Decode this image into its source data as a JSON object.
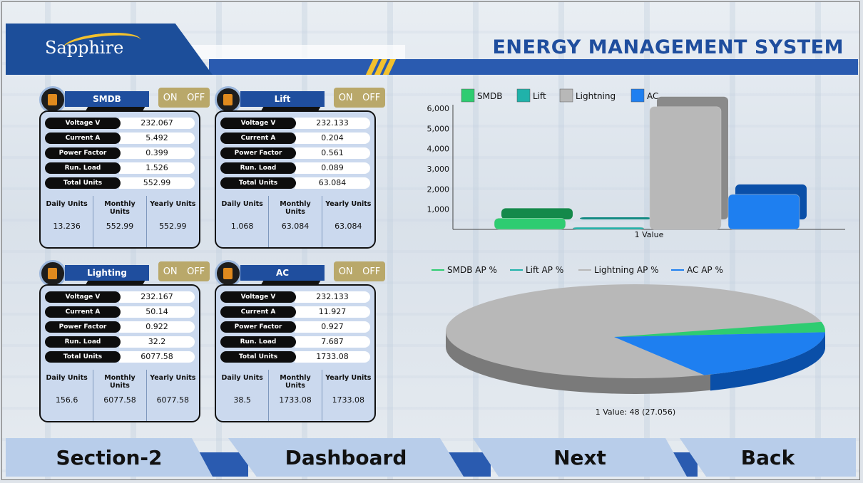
{
  "header": {
    "logo_text": "Sapphire",
    "title": "ENERGY  MANAGEMENT SYSTEM"
  },
  "panels": [
    {
      "name": "SMDB",
      "on_label": "ON",
      "off_label": "OFF",
      "rows": [
        {
          "label": "Voltage V",
          "value": "232.067"
        },
        {
          "label": "Current A",
          "value": "5.492"
        },
        {
          "label": "Power Factor",
          "value": "0.399"
        },
        {
          "label": "Run. Load",
          "value": "1.526"
        },
        {
          "label": "Total Units",
          "value": "552.99"
        }
      ],
      "stats": [
        {
          "label": "Daily Units",
          "value": "13.236"
        },
        {
          "label": "Monthly Units",
          "value": "552.99"
        },
        {
          "label": "Yearly Units",
          "value": "552.99"
        }
      ]
    },
    {
      "name": "Lift",
      "on_label": "ON",
      "off_label": "OFF",
      "rows": [
        {
          "label": "Voltage V",
          "value": "232.133"
        },
        {
          "label": "Current A",
          "value": "0.204"
        },
        {
          "label": "Power Factor",
          "value": "0.561"
        },
        {
          "label": "Run. Load",
          "value": "0.089"
        },
        {
          "label": "Total Units",
          "value": "63.084"
        }
      ],
      "stats": [
        {
          "label": "Daily Units",
          "value": "1.068"
        },
        {
          "label": "Monthly Units",
          "value": "63.084"
        },
        {
          "label": "Yearly Units",
          "value": "63.084"
        }
      ]
    },
    {
      "name": "Lighting",
      "on_label": "ON",
      "off_label": "OFF",
      "rows": [
        {
          "label": "Voltage V",
          "value": "232.167"
        },
        {
          "label": "Current A",
          "value": "50.14"
        },
        {
          "label": "Power Factor",
          "value": "0.922"
        },
        {
          "label": "Run. Load",
          "value": "32.2"
        },
        {
          "label": "Total Units",
          "value": "6077.58"
        }
      ],
      "stats": [
        {
          "label": "Daily Units",
          "value": "156.6"
        },
        {
          "label": "Monthly Units",
          "value": "6077.58"
        },
        {
          "label": "Yearly Units",
          "value": "6077.58"
        }
      ]
    },
    {
      "name": "AC",
      "on_label": "ON",
      "off_label": "OFF",
      "rows": [
        {
          "label": "Voltage V",
          "value": "232.133"
        },
        {
          "label": "Current A",
          "value": "11.927"
        },
        {
          "label": "Power Factor",
          "value": "0.927"
        },
        {
          "label": "Run. Load",
          "value": "7.687"
        },
        {
          "label": "Total Units",
          "value": "1733.08"
        }
      ],
      "stats": [
        {
          "label": "Daily Units",
          "value": "38.5"
        },
        {
          "label": "Monthly Units",
          "value": "1733.08"
        },
        {
          "label": "Yearly Units",
          "value": "1733.08"
        }
      ]
    }
  ],
  "bar_chart": {
    "legend": [
      "SMDB",
      "Lift",
      "Lightning",
      "AC"
    ],
    "x_label": "1 Value",
    "y_ticks": [
      "1,000",
      "2,000",
      "3,000",
      "4,000",
      "5,000",
      "6,000"
    ]
  },
  "pie_chart": {
    "legend": [
      "SMDB AP %",
      "Lift AP %",
      "Lightning AP %",
      "AC AP %"
    ],
    "caption": "1 Value: 48 (27.056)"
  },
  "chart_data": [
    {
      "type": "bar",
      "categories": [
        "1 Value"
      ],
      "series": [
        {
          "name": "SMDB",
          "values": [
            552.99
          ],
          "color": "#2ecc71"
        },
        {
          "name": "Lift",
          "values": [
            63.084
          ],
          "color": "#20b2aa"
        },
        {
          "name": "Lightning",
          "values": [
            6077.58
          ],
          "color": "#b8b8b8"
        },
        {
          "name": "AC",
          "values": [
            1733.08
          ],
          "color": "#1e7ff0"
        }
      ],
      "xlabel": "1 Value",
      "ylim": [
        0,
        6000
      ],
      "legend": "top-left"
    },
    {
      "type": "pie",
      "labels": [
        "SMDB AP %",
        "Lift AP %",
        "Lightning AP %",
        "AC AP %"
      ],
      "values": [
        3,
        0.5,
        75.5,
        21
      ],
      "colors": [
        "#2ecc71",
        "#20b2aa",
        "#b8b8b8",
        "#1e7ff0"
      ],
      "caption": "1 Value: 48 (27.056)",
      "legend": "top"
    }
  ],
  "nav": {
    "section": "Section-2",
    "dashboard": "Dashboard",
    "next": "Next",
    "back": "Back"
  }
}
